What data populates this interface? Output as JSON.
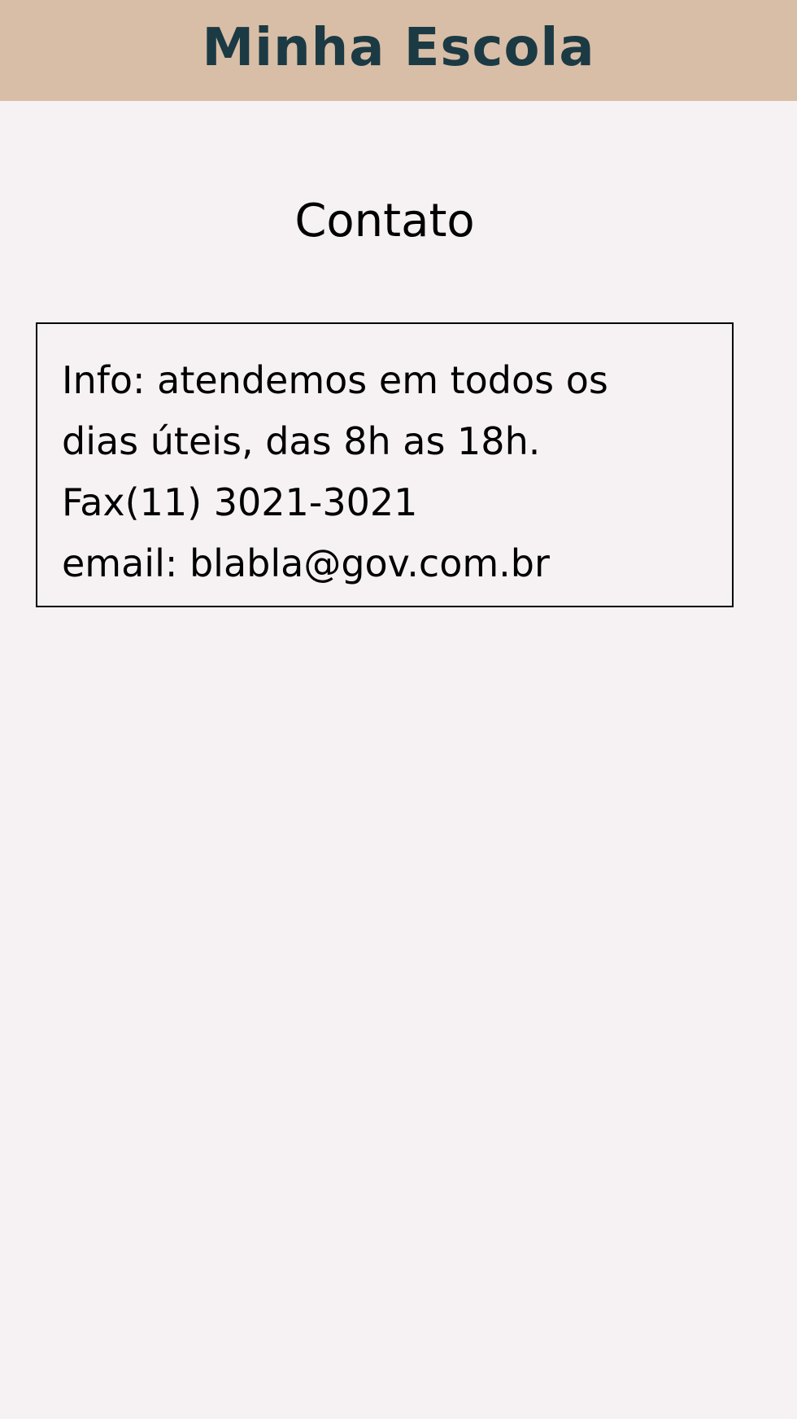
{
  "header": {
    "title": "Minha Escola",
    "background_color": "#d8bea6",
    "title_color": "#1b3a44"
  },
  "main": {
    "heading": "Contato",
    "contact": {
      "info_line_1": "Info: atendemos em todos os",
      "info_line_2": "dias úteis, das 8h as 18h.",
      "fax": "Fax(11) 3021-3021",
      "email": "email: blabla@gov.com.br"
    }
  },
  "colors": {
    "page_background": "#f6f2f4",
    "text": "#000000",
    "box_border": "#000000"
  }
}
